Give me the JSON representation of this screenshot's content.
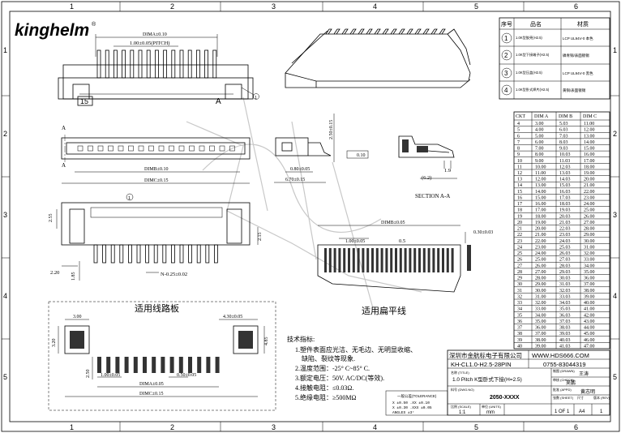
{
  "logo": {
    "text": "kinghelm",
    "registered": "®",
    "color": "#e41e2b"
  },
  "frame": {
    "cols": [
      "1",
      "2",
      "3",
      "4",
      "5",
      "6"
    ],
    "rows": [
      "1",
      "2",
      "3",
      "4",
      "5"
    ]
  },
  "views": {
    "front": {
      "dim_a": "DIMA±0.10",
      "pitch": "1.00±0.05(PITCH)",
      "pin_mark": "15",
      "row_mark": "A",
      "balloon": "1"
    },
    "top": {
      "section_mark": "A",
      "dim_b": "DIMB±0.10",
      "dim_c": "DIMC±0.15",
      "balloon": "2"
    },
    "side": {
      "height": "2.50±0.15",
      "d1": "0.80±0.05",
      "d2": "6.70±0.15",
      "flatness": "0.10"
    },
    "section": {
      "d1": "1.9",
      "d2": "(6.2)",
      "label": "SECTION A-A"
    },
    "bottom": {
      "h1": "2.55",
      "h2": "2.15",
      "w1": "2.20",
      "h3": "1.85",
      "pin_w": "N-0.25±0.02",
      "balloon": "1"
    },
    "fpc": {
      "dim_b": "DIMB±0.05",
      "pitch": "1.00±0.05",
      "width": "0.5",
      "thickness": "0.30±0.03",
      "label": "适用扁平线"
    },
    "pcb": {
      "title": "适用线路板",
      "d_left": "3.00",
      "d_right": "4.30±0.05",
      "h_left": "3.20",
      "h_right": "4.85",
      "h_pad": "2.50",
      "pitch": "1.00±0.05",
      "pad_w": "0.50±0.05",
      "dim_a": "DIMA±0.05",
      "dim_c": "DIMC±0.15"
    }
  },
  "materials": {
    "headers": [
      "序号",
      "品名",
      "材质"
    ],
    "rows": [
      {
        "no": "1",
        "name": "1.0K型胶壳(H2.5)",
        "material": "LCP UL94V-0 本色"
      },
      {
        "no": "2",
        "name": "1.0K型下接端子(H2.5)",
        "material": "磷青铜/表面镀锡"
      },
      {
        "no": "3",
        "name": "1.0K型压盖(H2.5)",
        "material": "LCP UL94V-0 黑色"
      },
      {
        "no": "4",
        "name": "1.0K型卧式焊片(H2.5)",
        "material": "黄铜/表面镀锡"
      }
    ]
  },
  "dim_table": {
    "headers": [
      "CKT",
      "DIM A",
      "DIM B",
      "DIM C"
    ],
    "rows": [
      [
        "4",
        "3.00",
        "5.03",
        "11.00"
      ],
      [
        "5",
        "4.00",
        "6.03",
        "12.00"
      ],
      [
        "6",
        "5.00",
        "7.03",
        "13.00"
      ],
      [
        "7",
        "6.00",
        "8.03",
        "14.00"
      ],
      [
        "8",
        "7.00",
        "9.03",
        "15.00"
      ],
      [
        "9",
        "8.00",
        "10.03",
        "16.00"
      ],
      [
        "10",
        "9.00",
        "11.03",
        "17.00"
      ],
      [
        "11",
        "10.00",
        "12.03",
        "18.00"
      ],
      [
        "12",
        "11.00",
        "13.03",
        "19.00"
      ],
      [
        "13",
        "12.00",
        "14.03",
        "20.00"
      ],
      [
        "14",
        "13.00",
        "15.03",
        "21.00"
      ],
      [
        "15",
        "14.00",
        "16.03",
        "22.00"
      ],
      [
        "16",
        "15.00",
        "17.03",
        "23.00"
      ],
      [
        "17",
        "16.00",
        "18.03",
        "24.00"
      ],
      [
        "18",
        "17.00",
        "19.03",
        "25.00"
      ],
      [
        "19",
        "18.00",
        "20.03",
        "26.00"
      ],
      [
        "20",
        "19.00",
        "21.03",
        "27.00"
      ],
      [
        "21",
        "20.00",
        "22.03",
        "28.00"
      ],
      [
        "22",
        "21.00",
        "23.03",
        "29.00"
      ],
      [
        "23",
        "22.00",
        "24.03",
        "30.00"
      ],
      [
        "24",
        "23.00",
        "25.03",
        "31.00"
      ],
      [
        "25",
        "24.00",
        "26.03",
        "32.00"
      ],
      [
        "26",
        "25.00",
        "27.03",
        "33.00"
      ],
      [
        "27",
        "26.00",
        "28.03",
        "34.00"
      ],
      [
        "28",
        "27.00",
        "29.03",
        "35.00"
      ],
      [
        "29",
        "28.00",
        "30.03",
        "36.00"
      ],
      [
        "30",
        "29.00",
        "31.03",
        "37.00"
      ],
      [
        "31",
        "30.00",
        "32.03",
        "38.00"
      ],
      [
        "32",
        "31.00",
        "33.03",
        "39.00"
      ],
      [
        "33",
        "32.00",
        "34.03",
        "40.00"
      ],
      [
        "34",
        "33.00",
        "35.03",
        "41.00"
      ],
      [
        "35",
        "34.00",
        "36.03",
        "42.00"
      ],
      [
        "36",
        "35.00",
        "37.03",
        "43.00"
      ],
      [
        "37",
        "36.00",
        "38.03",
        "44.00"
      ],
      [
        "38",
        "37.00",
        "39.03",
        "45.00"
      ],
      [
        "39",
        "38.00",
        "40.03",
        "46.00"
      ],
      [
        "40",
        "39.00",
        "41.03",
        "47.00"
      ]
    ]
  },
  "tech": {
    "title": "技术指标:",
    "items": [
      "1.塑件表面应光洁、无毛边、无明显收缩、",
      "缺陷、裂纹等现象.",
      "2.温度范围：-25° C~85° C.",
      "3.额定电压：50V. AC/DC(等效).",
      "4.接触电阻：≤0.03Ω.",
      "5.绝缘电阻：≥500MΩ"
    ]
  },
  "tolerance": {
    "title": "一般公差(TOLERANCE)",
    "lines": [
      "X ±0.50   .XX ±0.10",
      "X ±0.30   .XXX ±0.05",
      "ANGLES   ±3°"
    ]
  },
  "title_block": {
    "company": "深圳市金航标电子有限公司",
    "website": "WWW.HDS666.COM",
    "part_code": "KH-CL1.0-H2.5-28PIN",
    "phone": "0755-83044319",
    "title_label": "名称 (TITLE)",
    "title": "1.0 Pitch K型卧式下接(H=2.5)",
    "drawn_label": "制图 (DRAWN)",
    "drawn": "王涛",
    "check_label": "审核 (CHECK)",
    "check": "吴鹏",
    "appd_label": "批准 (APPD)",
    "appd": "黄志明",
    "dwg_label": "料号 (DWG.NO)",
    "dwg": "2050-XXXX",
    "scale_label": "比例 (SCALE)",
    "scale": "1:1",
    "unit_label": "单位 (UNITS)",
    "unit": "mm",
    "sheet_label": "张数 (SHEET)",
    "sheet": "1 OF 1",
    "size_label": "尺寸",
    "size": "A4",
    "rev_label": "版本 (REV)",
    "rev": "1"
  }
}
